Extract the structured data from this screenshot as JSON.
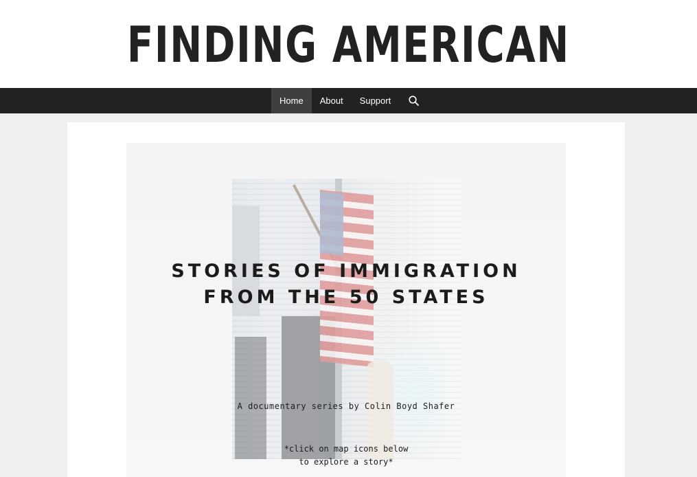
{
  "site": {
    "title": "FINDING AMERICAN"
  },
  "nav": {
    "items": [
      {
        "label": "Home",
        "active": true
      },
      {
        "label": "About",
        "active": false
      },
      {
        "label": "Support",
        "active": false
      }
    ],
    "search_icon": "search-icon"
  },
  "hero": {
    "heading_line1": "STORIES OF IMMIGRATION",
    "heading_line2": "FROM THE 50 STATES",
    "subtitle": "A documentary series by Colin Boyd Shafer",
    "note_line1": "*click on map icons below",
    "note_line2": "to explore a story*"
  },
  "colors": {
    "nav_background": "#222222",
    "nav_active": "#3f3f3f",
    "page_background": "#efefef",
    "title_text": "#222222"
  }
}
